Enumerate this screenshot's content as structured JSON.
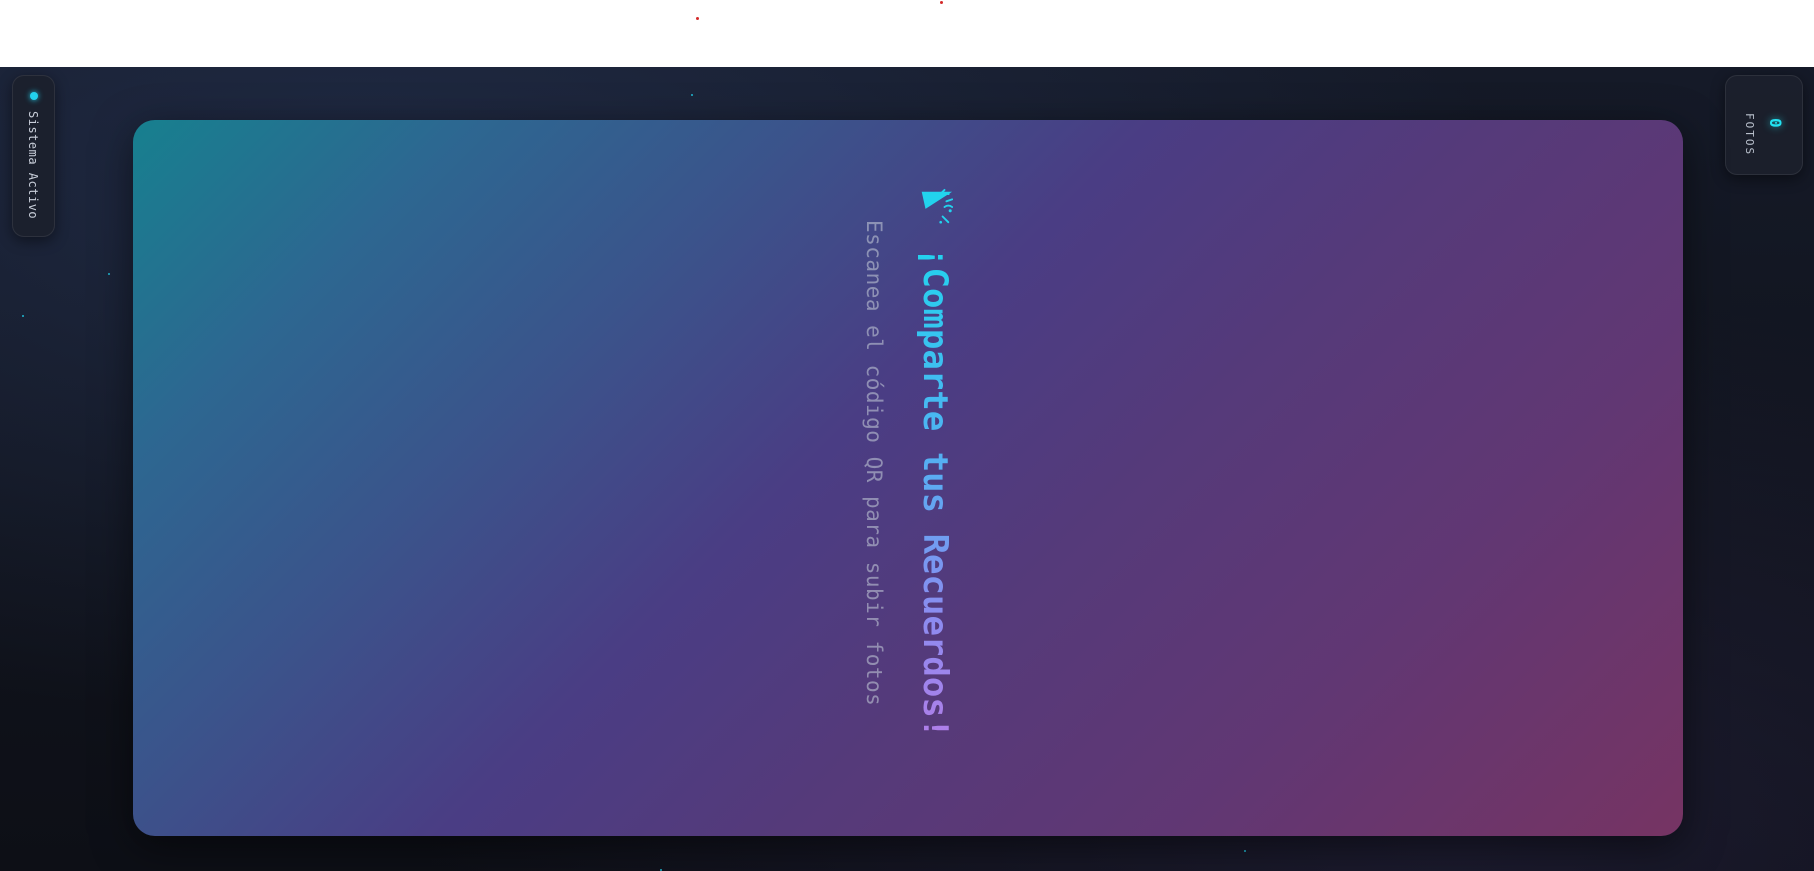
{
  "status": {
    "label": "Sistema Activo",
    "dot_color": "#22d3ee"
  },
  "counter": {
    "value": "0",
    "label": "FOTOS"
  },
  "card": {
    "icon": "party-popper-icon",
    "title": "¡Comparte tus Recuerdos!",
    "subtitle": "Escanea el código QR para subir fotos"
  },
  "colors": {
    "accent": "#22d3ee",
    "background": "#121624",
    "card_gradient_start": "#17808f",
    "card_gradient_mid": "#4a3d84",
    "card_gradient_end": "#763463"
  }
}
